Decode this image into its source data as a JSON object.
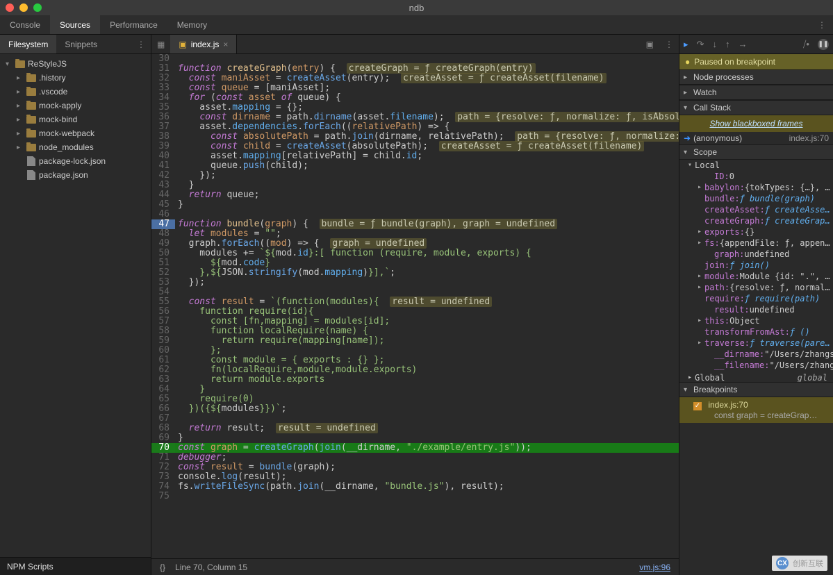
{
  "window": {
    "title": "ndb"
  },
  "topnav": {
    "tabs": [
      "Console",
      "Sources",
      "Performance",
      "Memory"
    ],
    "active": 1
  },
  "left": {
    "tabs": [
      "Filesystem",
      "Snippets"
    ],
    "active": 0,
    "tree": [
      {
        "name": "ReStyleJS",
        "type": "folder",
        "depth": 0,
        "expanded": true
      },
      {
        "name": ".history",
        "type": "folder",
        "depth": 1
      },
      {
        "name": ".vscode",
        "type": "folder",
        "depth": 1
      },
      {
        "name": "mock-apply",
        "type": "folder",
        "depth": 1
      },
      {
        "name": "mock-bind",
        "type": "folder",
        "depth": 1
      },
      {
        "name": "mock-webpack",
        "type": "folder",
        "depth": 1
      },
      {
        "name": "node_modules",
        "type": "folder",
        "depth": 1
      },
      {
        "name": "package-lock.json",
        "type": "file",
        "depth": 1
      },
      {
        "name": "package.json",
        "type": "file",
        "depth": 1
      }
    ],
    "npm_scripts": "NPM Scripts"
  },
  "editor": {
    "tab": {
      "file": "index.js"
    },
    "breakpoint_line": 47,
    "execution_line": 70,
    "lines": [
      {
        "n": 30,
        "html": ""
      },
      {
        "n": 31,
        "html": "<span class='kw'>function</span> <span class='def'>createGraph</span>(<span class='id'>entry</span>) {  <span class='hint'>createGraph = ƒ createGraph(entry)</span>"
      },
      {
        "n": 32,
        "html": "  <span class='kw'>const</span> <span class='id'>maniAsset</span> = <span class='fn'>createAsset</span>(entry);  <span class='hint'>createAsset = ƒ createAsset(filename)</span>"
      },
      {
        "n": 33,
        "html": "  <span class='kw'>const</span> <span class='id'>queue</span> = [maniAsset];"
      },
      {
        "n": 34,
        "html": "  <span class='kw'>for</span> (<span class='kw'>const</span> <span class='id'>asset</span> <span class='kw'>of</span> queue) {"
      },
      {
        "n": 35,
        "html": "    asset.<span class='prop'>mapping</span> = {};"
      },
      {
        "n": 36,
        "html": "    <span class='kw'>const</span> <span class='id'>dirname</span> = path.<span class='fn'>dirname</span>(asset.<span class='prop'>filename</span>);  <span class='hint'>path = {resolve: ƒ, normalize: ƒ, isAbsolute: ƒ,</span>"
      },
      {
        "n": 37,
        "html": "    asset.<span class='prop'>dependencies</span>.<span class='fn'>forEach</span>((<span class='id'>relativePath</span>) =&gt; {"
      },
      {
        "n": 38,
        "html": "      <span class='kw'>const</span> <span class='id'>absolutePath</span> = path.<span class='fn'>join</span>(dirname, relativePath);  <span class='hint'>path = {resolve: ƒ, normalize: ƒ, isA</span>"
      },
      {
        "n": 39,
        "html": "      <span class='kw'>const</span> <span class='id'>child</span> = <span class='fn'>createAsset</span>(absolutePath);  <span class='hint'>createAsset = ƒ createAsset(filename)</span>"
      },
      {
        "n": 40,
        "html": "      asset.<span class='prop'>mapping</span>[relativePath] = child.<span class='prop'>id</span>;"
      },
      {
        "n": 41,
        "html": "      queue.<span class='fn'>push</span>(child);"
      },
      {
        "n": 42,
        "html": "    });"
      },
      {
        "n": 43,
        "html": "  }"
      },
      {
        "n": 44,
        "html": "  <span class='kw'>return</span> queue;"
      },
      {
        "n": 45,
        "html": "}"
      },
      {
        "n": 46,
        "html": ""
      },
      {
        "n": 47,
        "html": "<span class='kw'>function</span> <span class='def'>bundle</span>(<span class='id'>graph</span>) {  <span class='hint'>bundle = ƒ bundle(graph), graph = undefined</span>"
      },
      {
        "n": 48,
        "html": "  <span class='kw'>let</span> <span class='id'>modules</span> = <span class='str'>\"\"</span>;"
      },
      {
        "n": 49,
        "html": "  graph.<span class='fn'>forEach</span>((<span class='id'>mod</span>) =&gt; {  <span class='hint'>graph = undefined</span>"
      },
      {
        "n": 50,
        "html": "    modules += <span class='str'>`${</span>mod.<span class='prop'>id</span><span class='str'>}:[ function (require, module, exports) {</span>"
      },
      {
        "n": 51,
        "html": "<span class='str'>      ${</span>mod.<span class='prop'>code</span><span class='str'>}</span>"
      },
      {
        "n": 52,
        "html": "<span class='str'>    },${</span>JSON.<span class='fn'>stringify</span>(mod.<span class='prop'>mapping</span>)<span class='str'>}],`</span>;"
      },
      {
        "n": 53,
        "html": "  });"
      },
      {
        "n": 54,
        "html": ""
      },
      {
        "n": 55,
        "html": "  <span class='kw'>const</span> <span class='id'>result</span> = <span class='str'>`(function(modules){</span>  <span class='hint'>result = undefined</span>"
      },
      {
        "n": 56,
        "html": "<span class='str'>    function require(id){</span>"
      },
      {
        "n": 57,
        "html": "<span class='str'>      const [fn,mapping] = modules[id];</span>"
      },
      {
        "n": 58,
        "html": "<span class='str'>      function localRequire(name) {</span>"
      },
      {
        "n": 59,
        "html": "<span class='str'>        return require(mapping[name]);</span>"
      },
      {
        "n": 60,
        "html": "<span class='str'>      };</span>"
      },
      {
        "n": 61,
        "html": "<span class='str'>      const module = { exports : {} };</span>"
      },
      {
        "n": 62,
        "html": "<span class='str'>      fn(localRequire,module,module.exports)</span>"
      },
      {
        "n": 63,
        "html": "<span class='str'>      return module.exports</span>"
      },
      {
        "n": 64,
        "html": "<span class='str'>    }</span>"
      },
      {
        "n": 65,
        "html": "<span class='str'>    require(0)</span>"
      },
      {
        "n": 66,
        "html": "<span class='str'>  })({${</span>modules<span class='str'>}})`</span>;"
      },
      {
        "n": 67,
        "html": ""
      },
      {
        "n": 68,
        "html": "  <span class='kw'>return</span> result;  <span class='hint'>result = undefined</span>"
      },
      {
        "n": 69,
        "html": "}"
      },
      {
        "n": 70,
        "html": "<span class='kw'>const</span> <span class='id'>graph</span> = <span class='fn'>createGraph</span>(<span class='fn'>join</span>(__dirname, <span class='str'>\"./example/entry.js\"</span>));"
      },
      {
        "n": 71,
        "html": "<span class='kw'>debugger</span>;"
      },
      {
        "n": 72,
        "html": "<span class='kw'>const</span> <span class='id'>result</span> = <span class='fn'>bundle</span>(graph);"
      },
      {
        "n": 73,
        "html": "console.<span class='fn'>log</span>(result);"
      },
      {
        "n": 74,
        "html": "fs.<span class='fn'>writeFileSync</span>(path.<span class='fn'>join</span>(__dirname, <span class='str'>\"bundle.js\"</span>), result);"
      },
      {
        "n": 75,
        "html": ""
      }
    ]
  },
  "status": {
    "braces": "{}",
    "pos": "Line 70, Column 15",
    "source": "vm.js:96"
  },
  "debugger": {
    "banner": "Paused on breakpoint",
    "sections": {
      "node_processes": "Node processes",
      "watch": "Watch",
      "call_stack": "Call Stack",
      "scope": "Scope",
      "breakpoints": "Breakpoints"
    },
    "callstack": {
      "show_blackboxed": "Show blackboxed frames",
      "frame": {
        "name": "(anonymous)",
        "loc": "index.js:70"
      }
    },
    "scope": {
      "local_label": "Local",
      "rows": [
        {
          "ar": "",
          "k": "ID",
          "v": "0",
          "inner": true
        },
        {
          "ar": "▸",
          "k": "babylon",
          "v": "{tokTypes: {…}, …"
        },
        {
          "ar": "",
          "k": "bundle",
          "v": "ƒ bundle(graph)",
          "fi": true
        },
        {
          "ar": "",
          "k": "createAsset",
          "v": "ƒ createAsse…",
          "fi": true
        },
        {
          "ar": "",
          "k": "createGraph",
          "v": "ƒ createGrap…",
          "fi": true
        },
        {
          "ar": "▸",
          "k": "exports",
          "v": "{}"
        },
        {
          "ar": "▸",
          "k": "fs",
          "v": "{appendFile: ƒ, appen…"
        },
        {
          "ar": "",
          "k": "graph",
          "v": "undefined",
          "inner": true
        },
        {
          "ar": "",
          "k": "join",
          "v": "ƒ join()",
          "fi": true
        },
        {
          "ar": "▸",
          "k": "module",
          "v": "Module {id: \".\", …"
        },
        {
          "ar": "▸",
          "k": "path",
          "v": "{resolve: ƒ, normal…"
        },
        {
          "ar": "",
          "k": "require",
          "v": "ƒ require(path)",
          "fi": true
        },
        {
          "ar": "",
          "k": "result",
          "v": "undefined",
          "inner": true
        },
        {
          "ar": "▸",
          "k": "this",
          "v": "Object"
        },
        {
          "ar": "",
          "k": "transformFromAst",
          "v": "ƒ ()",
          "fi": true
        },
        {
          "ar": "▸",
          "k": "traverse",
          "v": "ƒ traverse(pare…",
          "fi": true
        },
        {
          "ar": "",
          "k": "__dirname",
          "v": "\"/Users/zhangs…",
          "inner": true
        },
        {
          "ar": "",
          "k": "__filename",
          "v": "\"/Users/zhang…",
          "inner": true
        }
      ],
      "global": {
        "label": "Global",
        "value": "global"
      }
    },
    "breakpoints": {
      "item": {
        "file": "index.js:70",
        "snippet": "const graph = createGrap…"
      }
    }
  },
  "watermark": "创新互联"
}
